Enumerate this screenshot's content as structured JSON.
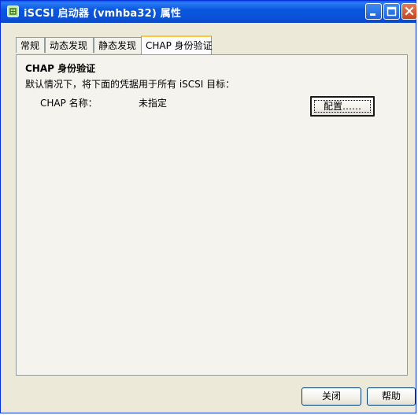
{
  "window": {
    "title": "iSCSI 启动器 (vmhba32) 属性"
  },
  "tabs": [
    {
      "label": "常规",
      "active": false
    },
    {
      "label": "动态发现",
      "active": false
    },
    {
      "label": "静态发现",
      "active": false
    },
    {
      "label": "CHAP 身份验证",
      "active": true
    }
  ],
  "chap": {
    "section_title": "CHAP 身份验证",
    "description": "默认情况下，将下面的凭据用于所有 iSCSI 目标：",
    "name_label": "CHAP 名称：",
    "name_value": "未指定",
    "configure_label": "配置……"
  },
  "footer": {
    "close_label": "关闭",
    "help_label": "帮助"
  },
  "colors": {
    "titlebar": "#0a58e0",
    "window_face": "#ece9d8",
    "tab_panel": "#f4f3ee",
    "active_tab_accent": "#ffc83c",
    "close_button": "#c8421c"
  },
  "icons": {
    "title": "iscsi-app-icon",
    "minimize": "minimize-icon",
    "maximize": "maximize-icon",
    "close": "close-icon"
  }
}
